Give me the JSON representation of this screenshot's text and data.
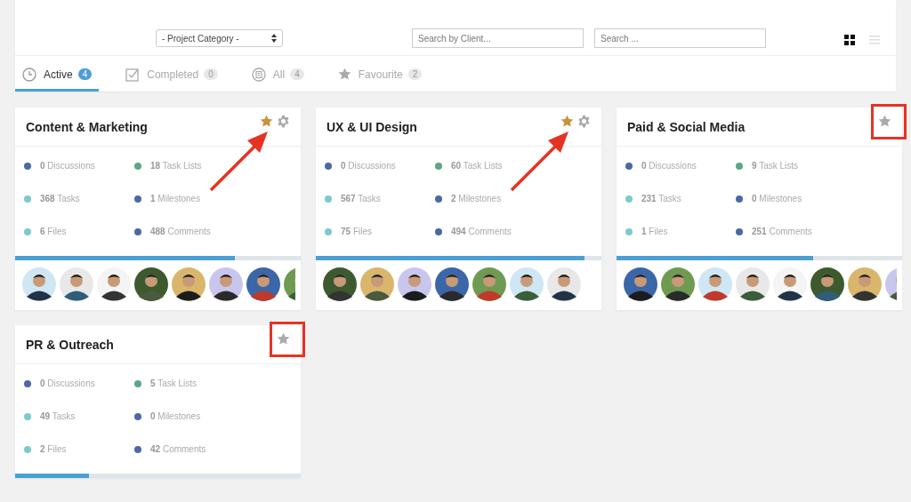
{
  "filters": {
    "category": "- Project Category -",
    "client_placeholder": "Search by Client...",
    "search_placeholder": "Search ..."
  },
  "tabs": [
    {
      "kind": "clock",
      "label": "Active",
      "count": "4",
      "selected": true
    },
    {
      "kind": "check",
      "label": "Completed",
      "count": "0",
      "selected": false
    },
    {
      "kind": "all",
      "label": "All",
      "count": "4",
      "selected": false
    },
    {
      "kind": "star",
      "label": "Favourite",
      "count": "2",
      "selected": false
    }
  ],
  "view_toggle": [
    {
      "kind": "grid",
      "selected": true
    },
    {
      "kind": "list",
      "selected": false
    }
  ],
  "projects": [
    {
      "title": "Content & Marketing",
      "favourite": true,
      "settings": true,
      "annotation": {
        "kind": "arrow"
      },
      "level": 0.77,
      "stats": [
        {
          "text": "**0** Discussions",
          "color": "#4a6aa5"
        },
        {
          "text": "**18** Task Lists",
          "color": "#5ea684"
        },
        {
          "text": "**368** Tasks",
          "color": "#7ccacb"
        },
        {
          "text": "**1** Milestones",
          "color": "#4a6aa5"
        },
        {
          "text": "**6** Files",
          "color": "#7ccacb"
        },
        {
          "text": "**488** Comments",
          "color": "#4a6aa5"
        }
      ],
      "avatars": [
        {
          "kind": "picture"
        },
        {
          "kind": "picture"
        },
        {
          "kind": "picture"
        },
        {
          "kind": "picture"
        },
        {
          "kind": "picture"
        },
        {
          "kind": "picture"
        },
        {
          "kind": "picture"
        },
        {
          "kind": "picture"
        }
      ]
    },
    {
      "title": "UX & UI Design",
      "favourite": true,
      "settings": true,
      "annotation": {
        "kind": "arrow"
      },
      "level": 0.94,
      "stats": [
        {
          "text": "**0** Discussions",
          "color": "#4a6aa5"
        },
        {
          "text": "**60** Task Lists",
          "color": "#5ea684"
        },
        {
          "text": "**567** Tasks",
          "color": "#7ccacb"
        },
        {
          "text": "**2** Milestones",
          "color": "#4a6aa5"
        },
        {
          "text": "**75** Files",
          "color": "#7ccacb"
        },
        {
          "text": "**494** Comments",
          "color": "#4a6aa5"
        }
      ],
      "avatars": [
        {
          "kind": "picture"
        },
        {
          "kind": "picture"
        },
        {
          "kind": "picture"
        },
        {
          "kind": "picture"
        },
        {
          "kind": "picture"
        },
        {
          "kind": "picture"
        },
        {
          "kind": "picture"
        }
      ]
    },
    {
      "title": "Paid & Social Media",
      "favourite": false,
      "settings": false,
      "annotation": {
        "kind": "box"
      },
      "level": 0.69,
      "stats": [
        {
          "text": "**0** Discussions",
          "color": "#4a6aa5"
        },
        {
          "text": "**9** Task Lists",
          "color": "#5ea684"
        },
        {
          "text": "**231** Tasks",
          "color": "#7ccacb"
        },
        {
          "text": "**0** Milestones",
          "color": "#4a6aa5"
        },
        {
          "text": "**1** Files",
          "color": "#7ccacb"
        },
        {
          "text": "**251** Comments",
          "color": "#4a6aa5"
        }
      ],
      "avatars": [
        {
          "kind": "picture"
        },
        {
          "kind": "picture"
        },
        {
          "kind": "picture"
        },
        {
          "kind": "picture"
        },
        {
          "kind": "picture"
        },
        {
          "kind": "picture"
        },
        {
          "kind": "picture"
        },
        {
          "kind": "picture"
        }
      ]
    },
    {
      "title": "PR & Outreach",
      "favourite": false,
      "settings": false,
      "annotation": {
        "kind": "box"
      },
      "level": 0.26,
      "stats": [
        {
          "text": "**0** Discussions",
          "color": "#4a6aa5"
        },
        {
          "text": "**5** Task Lists",
          "color": "#5ea684"
        },
        {
          "text": "**49** Tasks",
          "color": "#7ccacb"
        },
        {
          "text": "**0** Milestones",
          "color": "#4a6aa5"
        },
        {
          "text": "**2** Files",
          "color": "#7ccacb"
        },
        {
          "text": "**42** Comments",
          "color": "#4a6aa5"
        }
      ]
    }
  ]
}
